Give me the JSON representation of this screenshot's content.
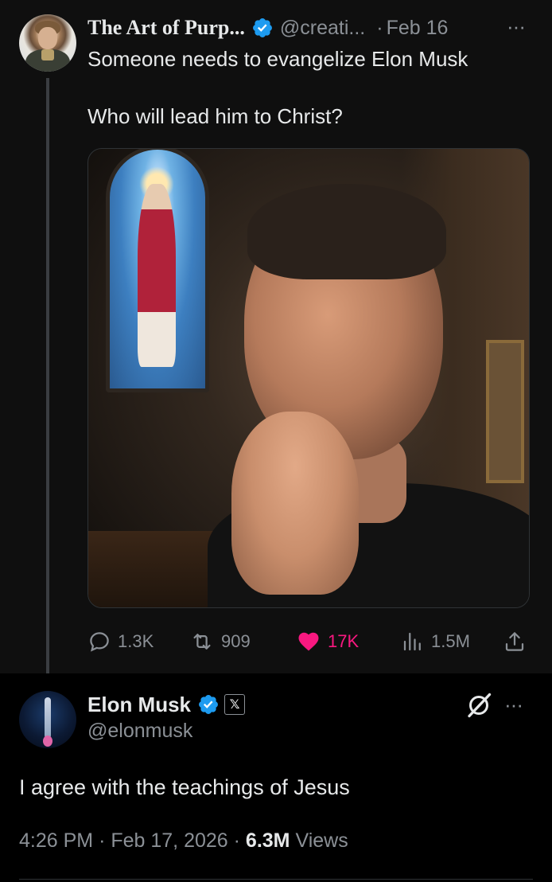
{
  "tweet1": {
    "display_name": "The Art of Purp...",
    "handle": "@creati...",
    "separator": "·",
    "date": "Feb 16",
    "more": "···",
    "text_line1": "Someone needs to evangelize Elon Musk",
    "text_line2": "Who will lead him to Christ?",
    "image_description": "Elon Musk praying in a church",
    "stats": {
      "replies": "1.3K",
      "reposts": "909",
      "likes": "17K",
      "views": "1.5M"
    }
  },
  "tweet2": {
    "display_name": "Elon Musk",
    "badge": "𝕏",
    "handle": "@elonmusk",
    "more": "···",
    "text": "I agree with the teachings of Jesus",
    "time": "4:26 PM",
    "separator": "·",
    "date": "Feb 17, 2026",
    "views_count": "6.3M",
    "views_label": "Views"
  },
  "colors": {
    "background": "#0f0f0f",
    "reply_background": "#000000",
    "text": "#e7e9ea",
    "muted": "#8b9096",
    "verified": "#1d9bf0",
    "like": "#f91880"
  },
  "icons": [
    "verified-badge-icon",
    "reply-icon",
    "repost-icon",
    "like-heart-icon",
    "views-icon",
    "share-icon",
    "grok-icon",
    "more-icon"
  ]
}
